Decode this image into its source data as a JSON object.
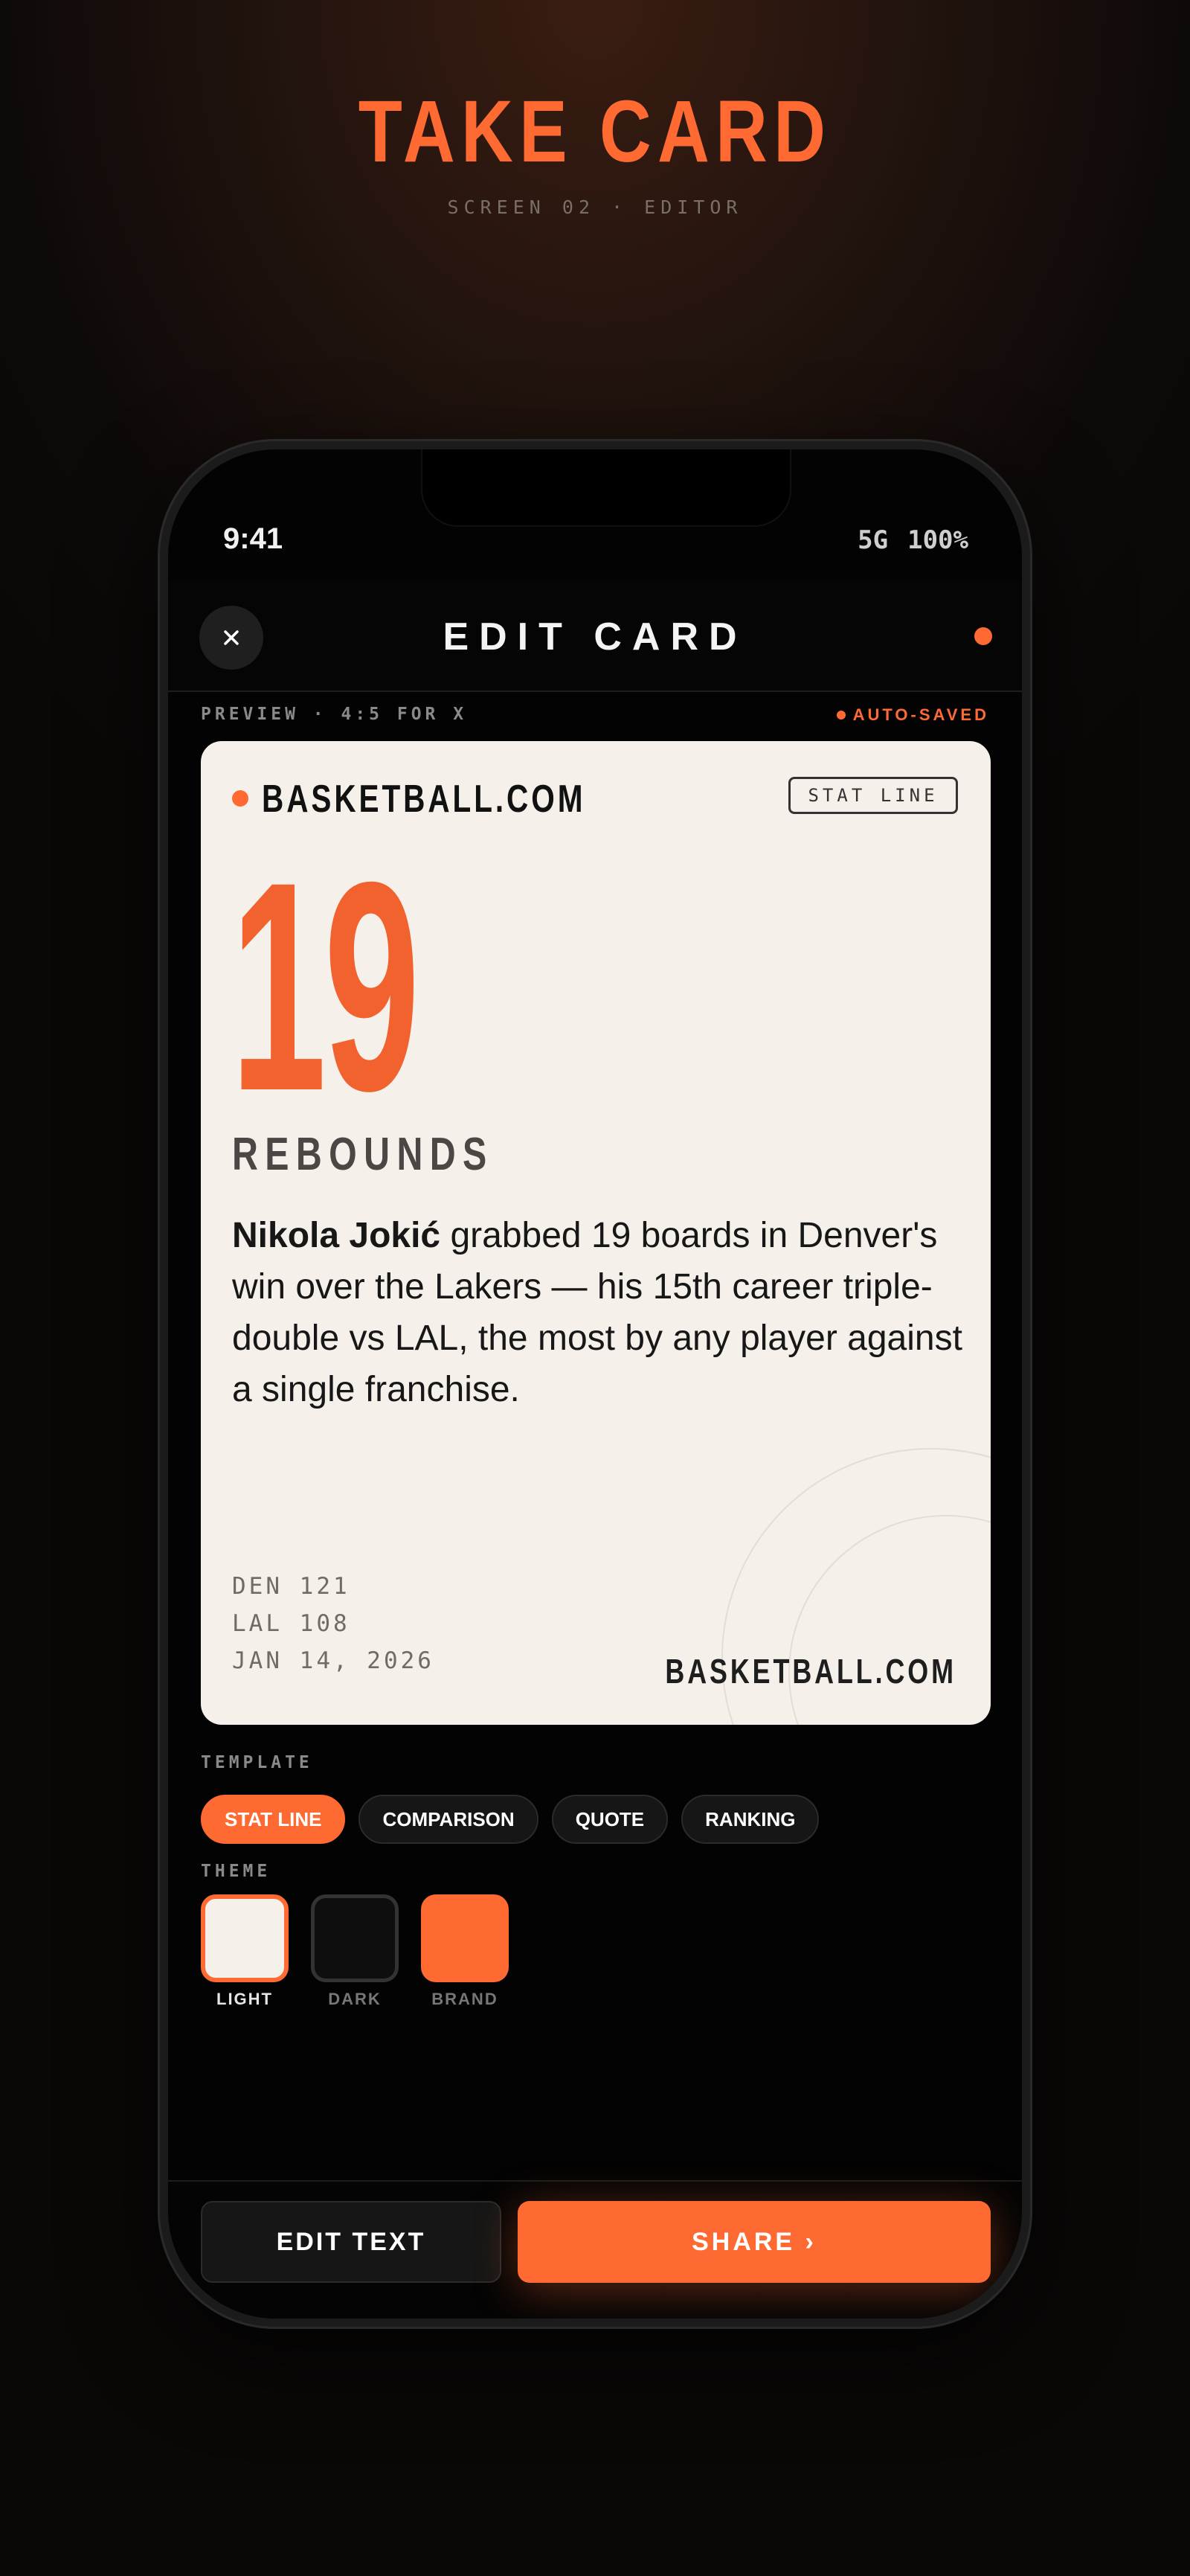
{
  "page": {
    "title": "TAKE CARD",
    "subtitle": "SCREEN 02 · EDITOR"
  },
  "status_bar": {
    "time": "9:41",
    "network": "5G",
    "battery": "100%"
  },
  "header": {
    "title": "EDIT CARD",
    "close_icon": "close-icon"
  },
  "preview": {
    "label": "PREVIEW · 4:5 FOR X",
    "saved_status": "AUTO-SAVED"
  },
  "card": {
    "brand": "BASKETBALL.COM",
    "tag": "STAT LINE",
    "stat_value": "19",
    "stat_label": "REBOUNDS",
    "player_name": "Nikola Jokić",
    "body": " grabbed 19 boards in Denver's win over the Lakers — his 15th career triple-double vs LAL, the most by any player against a single franchise.",
    "score_home": "DEN 121",
    "score_away": "LAL 108",
    "date": "JAN 14, 2026",
    "footer_brand": "BASKETBALL.COM"
  },
  "template": {
    "label": "TEMPLATE",
    "options": [
      "STAT LINE",
      "COMPARISON",
      "QUOTE",
      "RANKING"
    ],
    "selected": "STAT LINE"
  },
  "theme": {
    "label": "THEME",
    "options": [
      {
        "name": "LIGHT",
        "color": "#f5f0ea"
      },
      {
        "name": "DARK",
        "color": "#0e0e0e"
      },
      {
        "name": "BRAND",
        "color": "#ff6a33"
      }
    ],
    "selected": "LIGHT"
  },
  "actions": {
    "edit_text": "EDIT TEXT",
    "share": "SHARE ›"
  },
  "colors": {
    "accent": "#ff6a33",
    "card_bg": "#f5f0ea",
    "screen_bg": "#030303"
  }
}
